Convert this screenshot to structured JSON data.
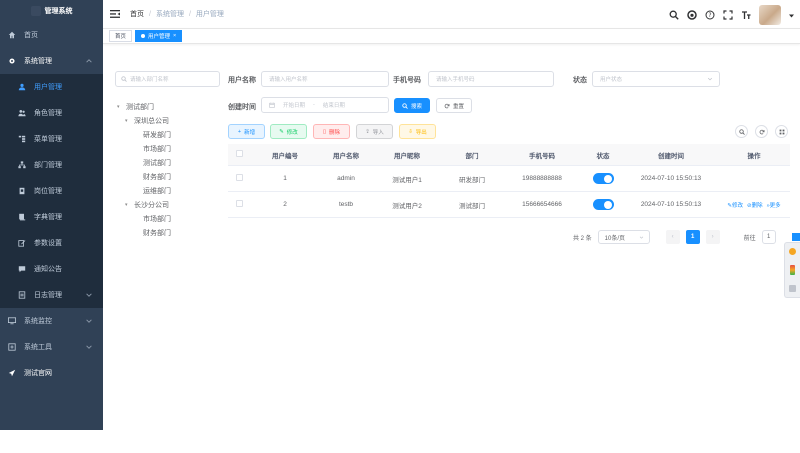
{
  "sidebar": {
    "title": "管理系统",
    "items": [
      {
        "label": "首页",
        "icon": "dashboard-icon",
        "level": "top"
      },
      {
        "label": "系统管理",
        "icon": "gear-icon",
        "level": "parent",
        "expanded": true
      },
      {
        "label": "用户管理",
        "icon": "user-icon",
        "level": "sub",
        "active": true
      },
      {
        "label": "角色管理",
        "icon": "peoples-icon",
        "level": "sub"
      },
      {
        "label": "菜单管理",
        "icon": "tree-table-icon",
        "level": "sub"
      },
      {
        "label": "部门管理",
        "icon": "tree-icon",
        "level": "sub"
      },
      {
        "label": "岗位管理",
        "icon": "post-icon",
        "level": "sub"
      },
      {
        "label": "字典管理",
        "icon": "dict-icon",
        "level": "sub"
      },
      {
        "label": "参数设置",
        "icon": "edit-icon",
        "level": "sub"
      },
      {
        "label": "通知公告",
        "icon": "message-icon",
        "level": "sub"
      },
      {
        "label": "日志管理",
        "icon": "log-icon",
        "level": "sub",
        "hasChildren": true
      },
      {
        "label": "系统监控",
        "icon": "monitor-icon",
        "level": "top",
        "hasChildren": true
      },
      {
        "label": "系统工具",
        "icon": "tool-icon",
        "level": "top",
        "hasChildren": true
      },
      {
        "label": "测试官网",
        "icon": "guide-icon",
        "level": "top"
      }
    ]
  },
  "breadcrumb": [
    "首页",
    "系统管理",
    "用户管理"
  ],
  "tags": [
    {
      "label": "首页",
      "active": false
    },
    {
      "label": "用户管理",
      "active": true
    }
  ],
  "tree": {
    "search_placeholder": "请输入部门名称",
    "nodes": [
      {
        "label": "测试部门",
        "depth": 0,
        "toggle": "open"
      },
      {
        "label": "深圳总公司",
        "depth": 1,
        "toggle": "open"
      },
      {
        "label": "研发部门",
        "depth": 2
      },
      {
        "label": "市场部门",
        "depth": 2
      },
      {
        "label": "测试部门",
        "depth": 2
      },
      {
        "label": "财务部门",
        "depth": 2
      },
      {
        "label": "运维部门",
        "depth": 2
      },
      {
        "label": "长沙分公司",
        "depth": 1,
        "toggle": "open"
      },
      {
        "label": "市场部门",
        "depth": 2
      },
      {
        "label": "财务部门",
        "depth": 2
      }
    ]
  },
  "filters": {
    "username_label": "用户名称",
    "username_placeholder": "请输入用户名称",
    "phone_label": "手机号码",
    "phone_placeholder": "请输入手机号码",
    "status_label": "状态",
    "status_placeholder": "用户状态",
    "created_label": "创建时间",
    "start_placeholder": "开始日期",
    "range_sep": "-",
    "end_placeholder": "结束日期",
    "search_button": "搜索",
    "reset_button": "重置"
  },
  "toolbar": {
    "add": "新增",
    "edit": "修改",
    "delete": "删除",
    "import": "导入",
    "export": "导出"
  },
  "table": {
    "columns": [
      "",
      "用户编号",
      "用户名称",
      "用户昵称",
      "部门",
      "手机号码",
      "状态",
      "创建时间",
      "操作"
    ],
    "rows": [
      {
        "id": "1",
        "username": "admin",
        "nickname": "测试用户1",
        "dept": "研发部门",
        "phone": "19888888888",
        "status_on": true,
        "created": "2024-07-10 15:50:13",
        "ops": []
      },
      {
        "id": "2",
        "username": "testb",
        "nickname": "测试用户2",
        "dept": "测试部门",
        "phone": "15666654666",
        "status_on": true,
        "created": "2024-07-10 15:50:13",
        "ops": [
          "修改",
          "删除",
          "更多"
        ]
      }
    ]
  },
  "pagination": {
    "total": "共 2 条",
    "page_size": "10条/页",
    "current_page": "1",
    "goto_label": "前往",
    "goto_value": "1"
  },
  "colors": {
    "sidebar_bg": "#304156",
    "submenu_bg": "#1f2d3d",
    "primary": "#1890ff",
    "active_menu": "#409eff"
  }
}
